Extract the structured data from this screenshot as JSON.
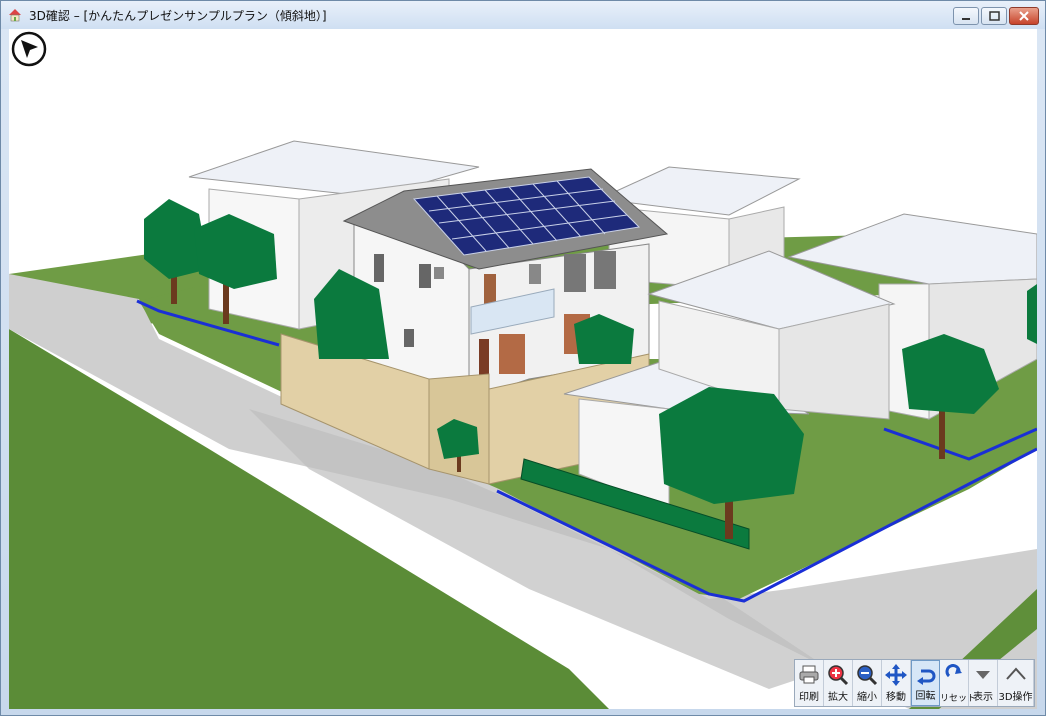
{
  "window": {
    "title": "3D確認 – [かんたんプレゼンサンプルプラン（傾斜地）]"
  },
  "icons": {
    "app": "house-app-icon",
    "navigation": "navigation-arrow-icon"
  },
  "toolbar": {
    "print": "印刷",
    "zoom_in": "拡大",
    "zoom_out": "縮小",
    "move": "移動",
    "rotate": "回転",
    "reset": "リセット",
    "display": "表示",
    "operation_3d": "3D操作"
  },
  "colors": {
    "grass": "#5f8f3a",
    "road": "#c9c9c9",
    "wall": "#e2d0a6",
    "tree": "#0b7a3e",
    "property_line": "#1a2fd6",
    "solar_panel": "#1e2a7a",
    "roof": "#eef1f7"
  }
}
